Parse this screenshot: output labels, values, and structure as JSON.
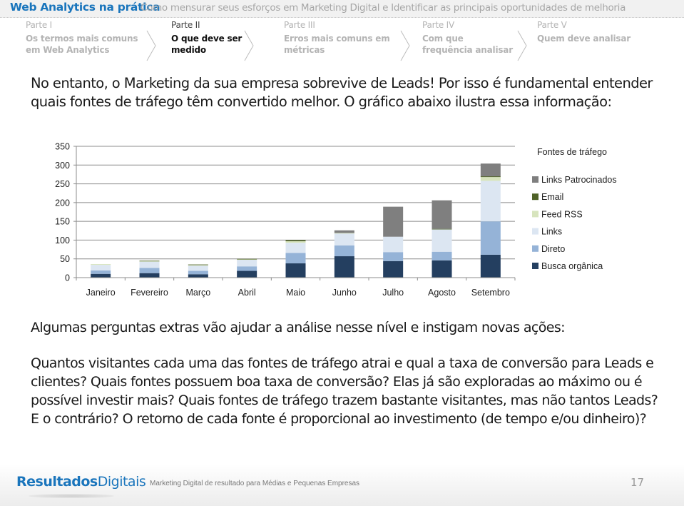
{
  "header": {
    "title": "Web Analytics na prática",
    "subtitle": "Como mensurar seus esforços em Marketing Digital e Identificar as principais oportunidades de melhoria"
  },
  "steps": [
    {
      "part": "Parte I",
      "name": "Os termos mais comuns em Web Analytics",
      "active": false
    },
    {
      "part": "Parte II",
      "name": "O que deve ser medido",
      "active": true
    },
    {
      "part": "Parte III",
      "name": "Erros mais comuns em métricas",
      "active": false
    },
    {
      "part": "Parte IV",
      "name": "Com que frequência analisar",
      "active": false
    },
    {
      "part": "Parte V",
      "name": "Quem deve analisar",
      "active": false
    }
  ],
  "intro": "No entanto, o Marketing da sua empresa sobrevive de Leads! Por isso é fundamental entender quais fontes de tráfego têm convertido melhor. O gráfico abaixo ilustra essa informação:",
  "chart_data": {
    "type": "bar",
    "stacked": true,
    "title": "",
    "xlabel": "",
    "ylabel": "",
    "ylim": [
      0,
      350
    ],
    "yticks": [
      0,
      50,
      100,
      150,
      200,
      250,
      300,
      350
    ],
    "grid": true,
    "legend_title": "Fontes de tráfego",
    "legend_position": "right",
    "categories": [
      "Janeiro",
      "Fevereiro",
      "Março",
      "Abril",
      "Maio",
      "Junho",
      "Julho",
      "Agosto",
      "Setembro"
    ],
    "series": [
      {
        "name": "Busca orgânica",
        "color": "#243f60",
        "values": [
          10,
          12,
          9,
          18,
          38,
          57,
          44,
          46,
          61
        ]
      },
      {
        "name": "Direto",
        "color": "#95b3d7",
        "values": [
          9,
          14,
          9,
          12,
          28,
          29,
          24,
          23,
          89
        ]
      },
      {
        "name": "Links",
        "color": "#dce6f2",
        "values": [
          15,
          17,
          14,
          18,
          27,
          32,
          41,
          60,
          108
        ]
      },
      {
        "name": "Feed RSS",
        "color": "#d7e4bd",
        "values": [
          2,
          1,
          2,
          1,
          4,
          1,
          0,
          0,
          10
        ]
      },
      {
        "name": "Email",
        "color": "#4f6228",
        "values": [
          0,
          1,
          1,
          1,
          3,
          0,
          0,
          1,
          2
        ]
      },
      {
        "name": "Links Patrocinados",
        "color": "#7f7f7f",
        "values": [
          0,
          0,
          0,
          0,
          0,
          7,
          80,
          76,
          34
        ]
      }
    ]
  },
  "questions_head": "Algumas perguntas extras vão ajudar a análise nesse nível e instigam novas ações:",
  "questions": "Quantos visitantes cada uma das fontes de tráfego atrai e qual a taxa de conversão para Leads e clientes? Quais fontes possuem boa taxa de conversão? Elas já são exploradas ao máximo ou é possível investir mais? Quais fontes de tráfego trazem bastante visitantes, mas não tantos Leads? E o contrário? O retorno de cada fonte é proporcional ao investimento (de tempo e/ou dinheiro)?",
  "footer": {
    "logo_bold": "Resultados",
    "logo_light": "Digitais",
    "tagline": "Marketing Digital de resultado para Médias e Pequenas Empresas",
    "page_number": "17"
  }
}
